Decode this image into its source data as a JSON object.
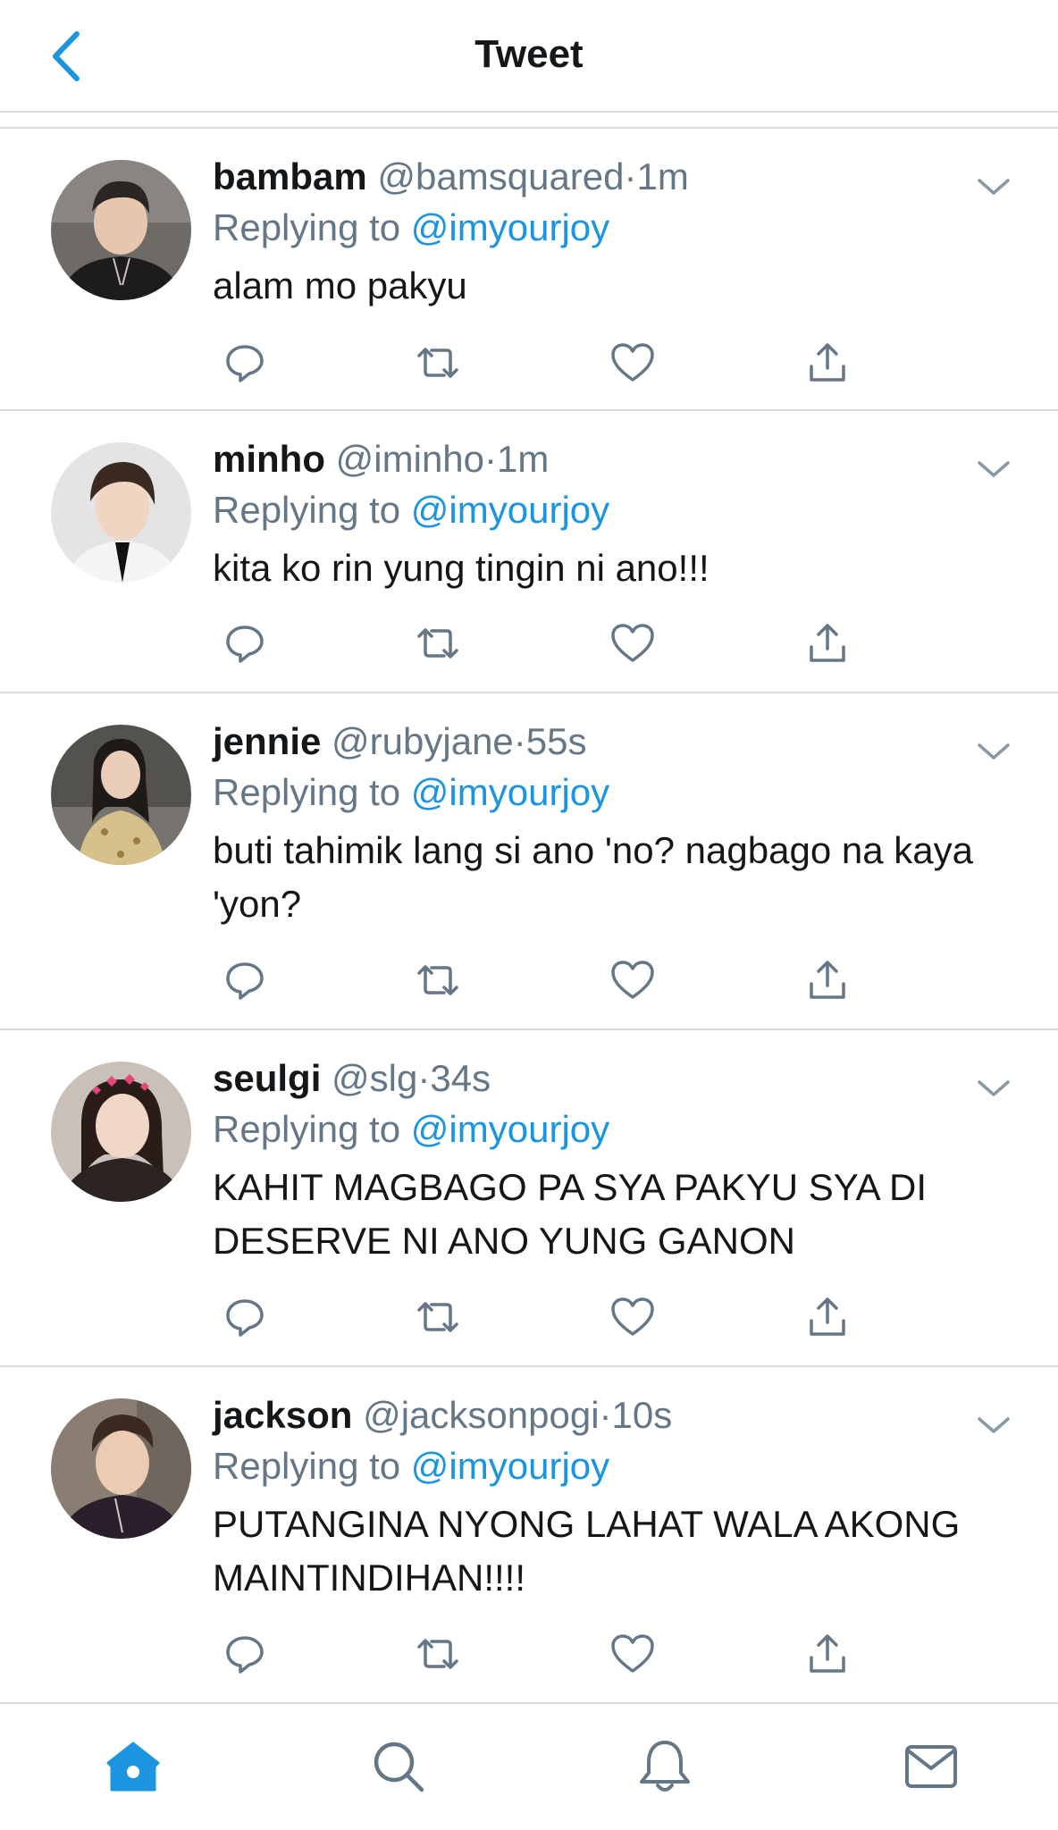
{
  "header": {
    "title": "Tweet"
  },
  "colors": {
    "accent": "#1b95e0",
    "muted": "#657786",
    "text": "#14171a",
    "divider": "#d6dbe0"
  },
  "tweets": [
    {
      "name": "bambam",
      "handle": "@bamsquared",
      "dot": "·",
      "time": "1m",
      "replying_prefix": "Replying to",
      "replying_to": "@imyourjoy",
      "text": "alam mo pakyu"
    },
    {
      "name": "minho",
      "handle": "@iminho",
      "dot": "·",
      "time": "1m",
      "replying_prefix": "Replying to",
      "replying_to": "@imyourjoy",
      "text": "kita ko rin yung tingin ni ano!!!"
    },
    {
      "name": "jennie",
      "handle": "@rubyjane",
      "dot": "·",
      "time": "55s",
      "replying_prefix": "Replying to",
      "replying_to": "@imyourjoy",
      "text": "buti tahimik lang si ano 'no? nagbago na kaya 'yon?"
    },
    {
      "name": "seulgi",
      "handle": "@slg",
      "dot": "·",
      "time": "34s",
      "replying_prefix": "Replying to",
      "replying_to": "@imyourjoy",
      "text": "KAHIT MAGBAGO PA SYA PAKYU SYA DI DESERVE NI ANO YUNG GANON"
    },
    {
      "name": "jackson",
      "handle": "@jacksonpogi",
      "dot": "·",
      "time": "10s",
      "replying_prefix": "Replying to",
      "replying_to": "@imyourjoy",
      "text": "PUTANGINA NYONG LAHAT WALA AKONG MAINTINDIHAN!!!!"
    }
  ],
  "icons": {
    "back": "chevron-left-icon",
    "caret": "chevron-down-icon",
    "reply": "reply-icon",
    "retweet": "retweet-icon",
    "like": "heart-icon",
    "share": "share-icon",
    "home": "home-icon",
    "search": "search-icon",
    "notifications": "bell-icon",
    "messages": "mail-icon"
  }
}
